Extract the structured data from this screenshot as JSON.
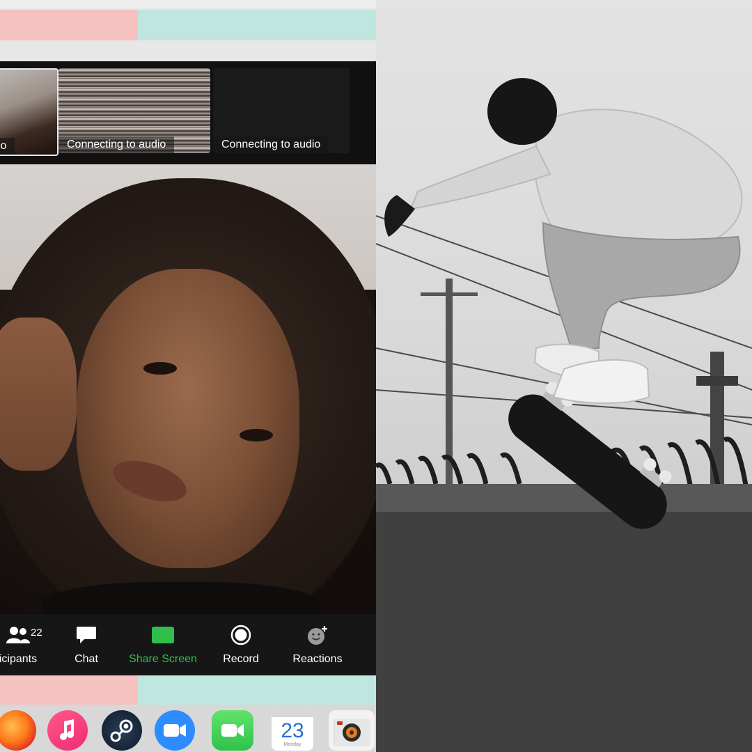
{
  "thumbnails": [
    {
      "caption": "dio"
    },
    {
      "caption": "Connecting to audio"
    },
    {
      "caption": "Connecting to audio"
    }
  ],
  "toolbar": {
    "participants": {
      "label": "icipants",
      "count": "22"
    },
    "chat": {
      "label": "Chat"
    },
    "share_screen": {
      "label": "Share Screen"
    },
    "record": {
      "label": "Record"
    },
    "reactions": {
      "label": "Reactions"
    }
  },
  "dock": {
    "calendar_day": "23",
    "calendar_sub": "Monday"
  },
  "colors": {
    "share_screen_green": "#2fbf4a",
    "toolbar_bg": "#161616",
    "desk_pink": "#f6c2c0",
    "desk_mint": "#bfe6df"
  }
}
